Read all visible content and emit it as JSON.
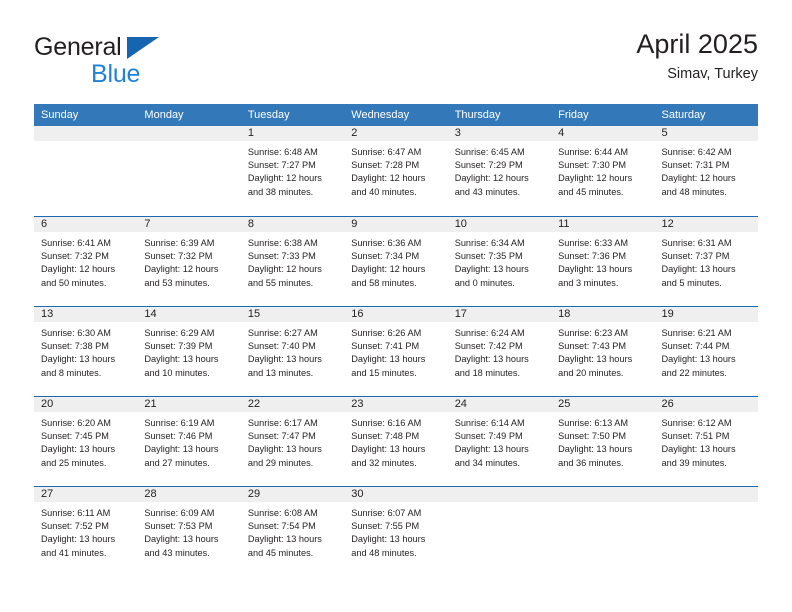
{
  "brand": {
    "name_part1": "General",
    "name_part2": "Blue",
    "triangle_color": "#1565b0",
    "blue_text_color": "#1f82d8"
  },
  "header": {
    "title": "April 2025",
    "location": "Simav, Turkey"
  },
  "theme": {
    "header_row_bg": "#3379b9",
    "row_separator": "#1d69ad",
    "date_band_bg": "#efefef",
    "text": "#231f20"
  },
  "weekdays": [
    "Sunday",
    "Monday",
    "Tuesday",
    "Wednesday",
    "Thursday",
    "Friday",
    "Saturday"
  ],
  "weeks": [
    [
      {
        "day": ""
      },
      {
        "day": ""
      },
      {
        "day": "1",
        "sunrise": "Sunrise: 6:48 AM",
        "sunset": "Sunset: 7:27 PM",
        "daylight_line1": "Daylight: 12 hours",
        "daylight_line2": "and 38 minutes."
      },
      {
        "day": "2",
        "sunrise": "Sunrise: 6:47 AM",
        "sunset": "Sunset: 7:28 PM",
        "daylight_line1": "Daylight: 12 hours",
        "daylight_line2": "and 40 minutes."
      },
      {
        "day": "3",
        "sunrise": "Sunrise: 6:45 AM",
        "sunset": "Sunset: 7:29 PM",
        "daylight_line1": "Daylight: 12 hours",
        "daylight_line2": "and 43 minutes."
      },
      {
        "day": "4",
        "sunrise": "Sunrise: 6:44 AM",
        "sunset": "Sunset: 7:30 PM",
        "daylight_line1": "Daylight: 12 hours",
        "daylight_line2": "and 45 minutes."
      },
      {
        "day": "5",
        "sunrise": "Sunrise: 6:42 AM",
        "sunset": "Sunset: 7:31 PM",
        "daylight_line1": "Daylight: 12 hours",
        "daylight_line2": "and 48 minutes."
      }
    ],
    [
      {
        "day": "6",
        "sunrise": "Sunrise: 6:41 AM",
        "sunset": "Sunset: 7:32 PM",
        "daylight_line1": "Daylight: 12 hours",
        "daylight_line2": "and 50 minutes."
      },
      {
        "day": "7",
        "sunrise": "Sunrise: 6:39 AM",
        "sunset": "Sunset: 7:32 PM",
        "daylight_line1": "Daylight: 12 hours",
        "daylight_line2": "and 53 minutes."
      },
      {
        "day": "8",
        "sunrise": "Sunrise: 6:38 AM",
        "sunset": "Sunset: 7:33 PM",
        "daylight_line1": "Daylight: 12 hours",
        "daylight_line2": "and 55 minutes."
      },
      {
        "day": "9",
        "sunrise": "Sunrise: 6:36 AM",
        "sunset": "Sunset: 7:34 PM",
        "daylight_line1": "Daylight: 12 hours",
        "daylight_line2": "and 58 minutes."
      },
      {
        "day": "10",
        "sunrise": "Sunrise: 6:34 AM",
        "sunset": "Sunset: 7:35 PM",
        "daylight_line1": "Daylight: 13 hours",
        "daylight_line2": "and 0 minutes."
      },
      {
        "day": "11",
        "sunrise": "Sunrise: 6:33 AM",
        "sunset": "Sunset: 7:36 PM",
        "daylight_line1": "Daylight: 13 hours",
        "daylight_line2": "and 3 minutes."
      },
      {
        "day": "12",
        "sunrise": "Sunrise: 6:31 AM",
        "sunset": "Sunset: 7:37 PM",
        "daylight_line1": "Daylight: 13 hours",
        "daylight_line2": "and 5 minutes."
      }
    ],
    [
      {
        "day": "13",
        "sunrise": "Sunrise: 6:30 AM",
        "sunset": "Sunset: 7:38 PM",
        "daylight_line1": "Daylight: 13 hours",
        "daylight_line2": "and 8 minutes."
      },
      {
        "day": "14",
        "sunrise": "Sunrise: 6:29 AM",
        "sunset": "Sunset: 7:39 PM",
        "daylight_line1": "Daylight: 13 hours",
        "daylight_line2": "and 10 minutes."
      },
      {
        "day": "15",
        "sunrise": "Sunrise: 6:27 AM",
        "sunset": "Sunset: 7:40 PM",
        "daylight_line1": "Daylight: 13 hours",
        "daylight_line2": "and 13 minutes."
      },
      {
        "day": "16",
        "sunrise": "Sunrise: 6:26 AM",
        "sunset": "Sunset: 7:41 PM",
        "daylight_line1": "Daylight: 13 hours",
        "daylight_line2": "and 15 minutes."
      },
      {
        "day": "17",
        "sunrise": "Sunrise: 6:24 AM",
        "sunset": "Sunset: 7:42 PM",
        "daylight_line1": "Daylight: 13 hours",
        "daylight_line2": "and 18 minutes."
      },
      {
        "day": "18",
        "sunrise": "Sunrise: 6:23 AM",
        "sunset": "Sunset: 7:43 PM",
        "daylight_line1": "Daylight: 13 hours",
        "daylight_line2": "and 20 minutes."
      },
      {
        "day": "19",
        "sunrise": "Sunrise: 6:21 AM",
        "sunset": "Sunset: 7:44 PM",
        "daylight_line1": "Daylight: 13 hours",
        "daylight_line2": "and 22 minutes."
      }
    ],
    [
      {
        "day": "20",
        "sunrise": "Sunrise: 6:20 AM",
        "sunset": "Sunset: 7:45 PM",
        "daylight_line1": "Daylight: 13 hours",
        "daylight_line2": "and 25 minutes."
      },
      {
        "day": "21",
        "sunrise": "Sunrise: 6:19 AM",
        "sunset": "Sunset: 7:46 PM",
        "daylight_line1": "Daylight: 13 hours",
        "daylight_line2": "and 27 minutes."
      },
      {
        "day": "22",
        "sunrise": "Sunrise: 6:17 AM",
        "sunset": "Sunset: 7:47 PM",
        "daylight_line1": "Daylight: 13 hours",
        "daylight_line2": "and 29 minutes."
      },
      {
        "day": "23",
        "sunrise": "Sunrise: 6:16 AM",
        "sunset": "Sunset: 7:48 PM",
        "daylight_line1": "Daylight: 13 hours",
        "daylight_line2": "and 32 minutes."
      },
      {
        "day": "24",
        "sunrise": "Sunrise: 6:14 AM",
        "sunset": "Sunset: 7:49 PM",
        "daylight_line1": "Daylight: 13 hours",
        "daylight_line2": "and 34 minutes."
      },
      {
        "day": "25",
        "sunrise": "Sunrise: 6:13 AM",
        "sunset": "Sunset: 7:50 PM",
        "daylight_line1": "Daylight: 13 hours",
        "daylight_line2": "and 36 minutes."
      },
      {
        "day": "26",
        "sunrise": "Sunrise: 6:12 AM",
        "sunset": "Sunset: 7:51 PM",
        "daylight_line1": "Daylight: 13 hours",
        "daylight_line2": "and 39 minutes."
      }
    ],
    [
      {
        "day": "27",
        "sunrise": "Sunrise: 6:11 AM",
        "sunset": "Sunset: 7:52 PM",
        "daylight_line1": "Daylight: 13 hours",
        "daylight_line2": "and 41 minutes."
      },
      {
        "day": "28",
        "sunrise": "Sunrise: 6:09 AM",
        "sunset": "Sunset: 7:53 PM",
        "daylight_line1": "Daylight: 13 hours",
        "daylight_line2": "and 43 minutes."
      },
      {
        "day": "29",
        "sunrise": "Sunrise: 6:08 AM",
        "sunset": "Sunset: 7:54 PM",
        "daylight_line1": "Daylight: 13 hours",
        "daylight_line2": "and 45 minutes."
      },
      {
        "day": "30",
        "sunrise": "Sunrise: 6:07 AM",
        "sunset": "Sunset: 7:55 PM",
        "daylight_line1": "Daylight: 13 hours",
        "daylight_line2": "and 48 minutes."
      },
      {
        "day": ""
      },
      {
        "day": ""
      },
      {
        "day": ""
      }
    ]
  ]
}
